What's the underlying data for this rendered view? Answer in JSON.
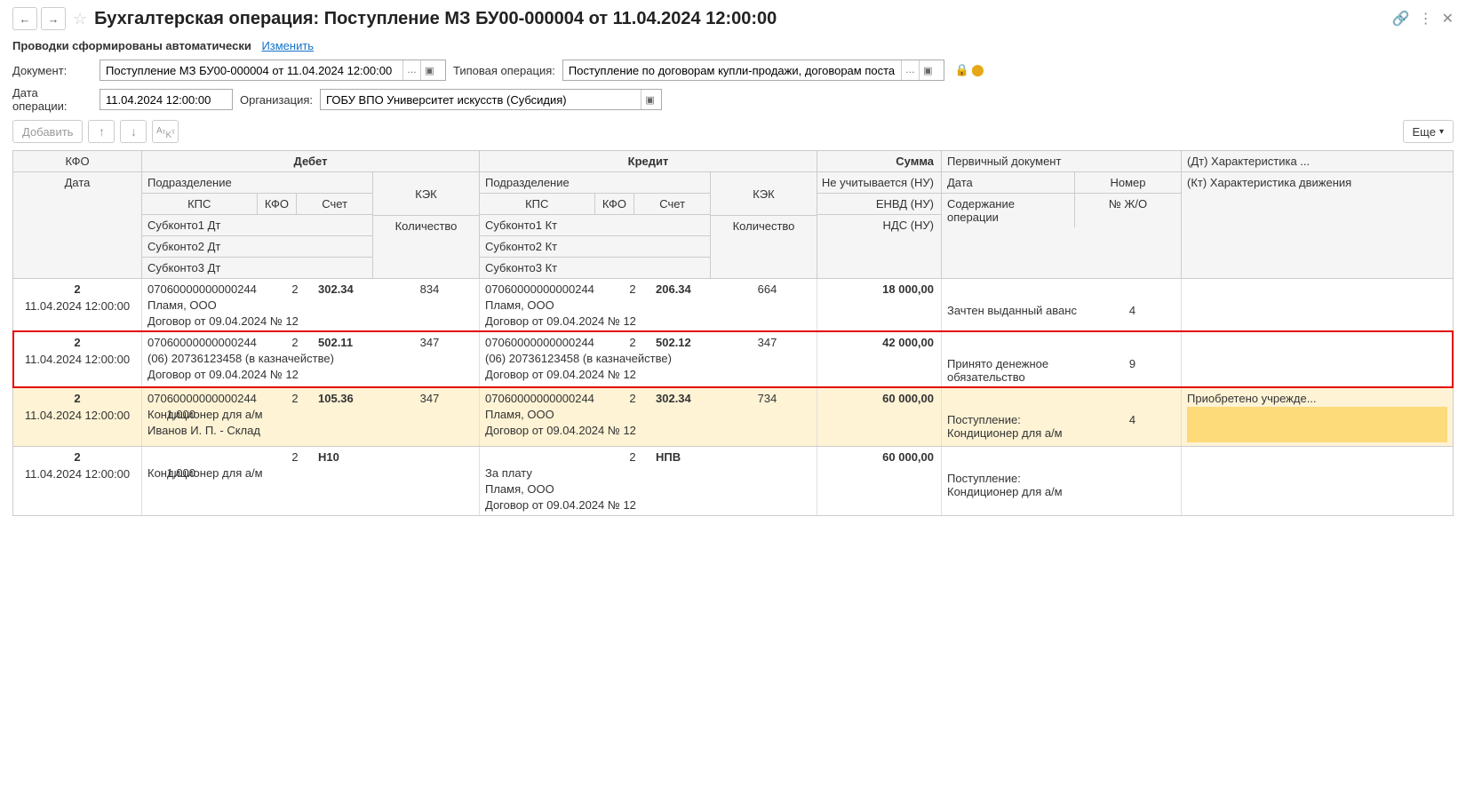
{
  "title": "Бухгалтерская операция: Поступление МЗ БУ00-000004 от 11.04.2024 12:00:00",
  "autoText": "Проводки сформированы автоматически",
  "changeLink": "Изменить",
  "labels": {
    "document": "Документ:",
    "typicalOp": "Типовая операция:",
    "opDate": "Дата операции:",
    "org": "Организация:",
    "add": "Добавить",
    "more": "Еще"
  },
  "fields": {
    "document": "Поступление МЗ БУ00-000004 от 11.04.2024 12:00:00",
    "typicalOp": "Поступление по договорам купли-продажи, договорам поставки, други",
    "opDate": "11.04.2024 12:00:00",
    "org": "ГОБУ ВПО Университет искусств (Субсидия)"
  },
  "headers": {
    "kfo": "КФО",
    "date": "Дата",
    "debet": "Дебет",
    "credit": "Кредит",
    "podr": "Подразделение",
    "kps": "КПС",
    "kfo2": "КФО",
    "schet": "Счет",
    "kek": "КЭК",
    "kol": "Количество",
    "sub1dt": "Субконто1 Дт",
    "sub2dt": "Субконто2 Дт",
    "sub3dt": "Субконто3 Дт",
    "sub1kt": "Субконто1 Кт",
    "sub2kt": "Субконто2 Кт",
    "sub3kt": "Субконто3 Кт",
    "summa": "Сумма",
    "neUch": "Не учитывается (НУ)",
    "envd": "ЕНВД (НУ)",
    "nds": "НДС (НУ)",
    "prim": "Первичный документ",
    "pdate": "Дата",
    "pnomer": "Номер",
    "soderzh": "Содержание операции",
    "nzo": "№ Ж/О",
    "chardt": "(Дт) Характеристика ...",
    "charkt": "(Кт) Характеристика движения"
  },
  "rows": [
    {
      "kfo": "2",
      "date": "11.04.2024 12:00:00",
      "dt": {
        "kps": "07060000000000244",
        "kfo": "2",
        "schet": "302.34",
        "kek": "834",
        "s1": "Пламя, ООО",
        "s2": "Договор от 09.04.2024 № 12",
        "s3": "",
        "qty": ""
      },
      "kt": {
        "kps": "07060000000000244",
        "kfo": "2",
        "schet": "206.34",
        "kek": "664",
        "s1": "Пламя, ООО",
        "s2": "Договор от 09.04.2024 № 12",
        "s3": "",
        "qty": ""
      },
      "summa": "18 000,00",
      "content": "Зачтен выданный аванс",
      "nzo": "4",
      "char": "",
      "highlight": false,
      "selected": false
    },
    {
      "kfo": "2",
      "date": "11.04.2024 12:00:00",
      "dt": {
        "kps": "07060000000000244",
        "kfo": "2",
        "schet": "502.11",
        "kek": "347",
        "s1": "(06) 20736123458 (в казначействе)",
        "s2": "Договор от 09.04.2024 № 12",
        "s3": "",
        "qty": ""
      },
      "kt": {
        "kps": "07060000000000244",
        "kfo": "2",
        "schet": "502.12",
        "kek": "347",
        "s1": "(06) 20736123458 (в казначействе)",
        "s2": "Договор от 09.04.2024 № 12",
        "s3": "",
        "qty": ""
      },
      "summa": "42 000,00",
      "content": "Принято денежное обязательство",
      "nzo": "9",
      "char": "",
      "highlight": true,
      "selected": false
    },
    {
      "kfo": "2",
      "date": "11.04.2024 12:00:00",
      "dt": {
        "kps": "07060000000000244",
        "kfo": "2",
        "schet": "105.36",
        "kek": "347",
        "s1": "Кондиционер для а/м",
        "s2": "Иванов И. П. - Склад",
        "s3": "",
        "qty": "1,000"
      },
      "kt": {
        "kps": "07060000000000244",
        "kfo": "2",
        "schet": "302.34",
        "kek": "734",
        "s1": "Пламя, ООО",
        "s2": "Договор от 09.04.2024 № 12",
        "s3": "",
        "qty": ""
      },
      "summa": "60 000,00",
      "content": "Поступление: Кондиционер для а/м",
      "nzo": "4",
      "char": "Приобретено учрежде...",
      "highlight": false,
      "selected": true
    },
    {
      "kfo": "2",
      "date": "11.04.2024 12:00:00",
      "dt": {
        "kps": "",
        "kfo": "2",
        "schet": "Н10",
        "kek": "",
        "s1": "Кондиционер для а/м",
        "s2": "",
        "s3": "",
        "qty": "1,000"
      },
      "kt": {
        "kps": "",
        "kfo": "2",
        "schet": "НПВ",
        "kek": "",
        "s1": "За плату",
        "s2": "Пламя, ООО",
        "s3": "Договор от 09.04.2024 № 12",
        "qty": ""
      },
      "summa": "60 000,00",
      "content": "Поступление: Кондиционер для а/м",
      "nzo": "",
      "char": "",
      "highlight": false,
      "selected": false
    }
  ]
}
